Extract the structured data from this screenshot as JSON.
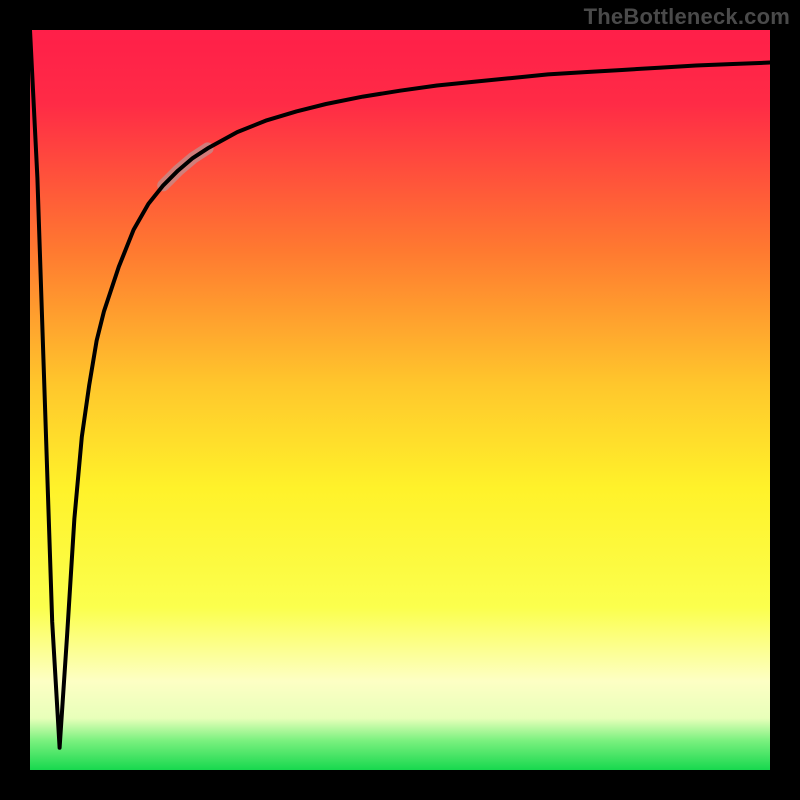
{
  "watermark": {
    "text": "TheBottleneck.com"
  },
  "accent_colors": {
    "gradient_top": "#ff1f49",
    "gradient_mid_upper": "#ff8e2b",
    "gradient_mid": "#fff22a",
    "gradient_lower": "#fdffb8",
    "gradient_green": "#27e356",
    "curve": "#000000",
    "highlight": "#c08f8f"
  },
  "chart_data": {
    "type": "line",
    "title": "",
    "xlabel": "",
    "ylabel": "",
    "xlim": [
      0,
      100
    ],
    "ylim": [
      0,
      100
    ],
    "notch_x": 4,
    "notch_y_min": 3,
    "highlight_x_range": [
      18,
      24
    ],
    "series": [
      {
        "name": "curve",
        "x": [
          0,
          1,
          2,
          3,
          4,
          5,
          6,
          7,
          8,
          9,
          10,
          12,
          14,
          16,
          18,
          20,
          22,
          24,
          28,
          32,
          36,
          40,
          45,
          50,
          55,
          60,
          65,
          70,
          75,
          80,
          85,
          90,
          95,
          100
        ],
        "y": [
          100,
          80,
          50,
          20,
          3,
          18,
          34,
          45,
          52,
          58,
          62,
          68,
          73,
          76.5,
          79,
          81,
          82.7,
          84,
          86.2,
          87.8,
          89,
          90,
          91,
          91.8,
          92.5,
          93,
          93.5,
          94,
          94.3,
          94.6,
          94.9,
          95.2,
          95.4,
          95.6
        ]
      }
    ]
  }
}
